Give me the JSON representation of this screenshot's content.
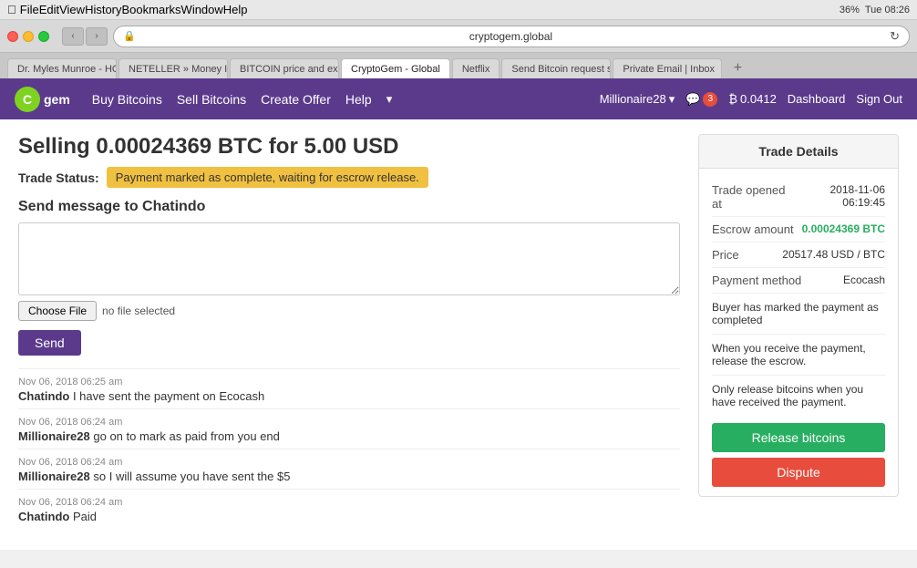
{
  "os": {
    "battery": "36%",
    "time": "Tue 08:26",
    "wifi": "WiFi"
  },
  "browser": {
    "url": "cryptogem.global",
    "tabs": [
      {
        "label": "Dr. Myles Munroe - HOW...",
        "active": false
      },
      {
        "label": "NETELLER » Money In",
        "active": false
      },
      {
        "label": "BITCOIN price and excha...",
        "active": false
      },
      {
        "label": "CryptoGem - Global",
        "active": true
      },
      {
        "label": "Netflix",
        "active": false
      },
      {
        "label": "Send Bitcoin request su...",
        "active": false
      },
      {
        "label": "Private Email | Inbox",
        "active": false
      }
    ]
  },
  "menu": {
    "items": [
      "File",
      "Edit",
      "View",
      "History",
      "Bookmarks",
      "Window",
      "Help"
    ]
  },
  "nav": {
    "logo_text": "gem",
    "links": [
      "Buy Bitcoins",
      "Sell Bitcoins",
      "Create Offer",
      "Help"
    ],
    "user": "Millionaire28",
    "chat_count": "3",
    "balance": "0.0412",
    "dashboard": "Dashboard",
    "signout": "Sign Out"
  },
  "page": {
    "title": "Selling 0.00024369 BTC for 5.00 USD",
    "trade_status_label": "Trade Status:",
    "trade_status_value": "Payment marked as complete, waiting for escrow release.",
    "send_message_title": "Send message to Chatindo",
    "message_placeholder": "",
    "choose_file_label": "Choose File",
    "no_file_label": "no file selected",
    "send_button": "Send",
    "messages": [
      {
        "time": "Nov 06, 2018 06:25 am",
        "author": "Chatindo",
        "text": "I have sent the payment on Ecocash"
      },
      {
        "time": "Nov 06, 2018 06:24 am",
        "author": "Millionaire28",
        "text": "go on to mark as paid from you end"
      },
      {
        "time": "Nov 06, 2018 06:24 am",
        "author": "Millionaire28",
        "text": "so I will assume you have sent the $5"
      },
      {
        "time": "Nov 06, 2018 06:24 am",
        "author": "Chatindo",
        "text": "Paid"
      }
    ]
  },
  "trade_details": {
    "header": "Trade Details",
    "trade_opened_label": "Trade opened at",
    "trade_opened_value": "2018-11-06 06:19:45",
    "escrow_label": "Escrow amount",
    "escrow_value": "0.00024369 BTC",
    "price_label": "Price",
    "price_value": "20517.48 USD / BTC",
    "payment_method_label": "Payment method",
    "payment_method_value": "Ecocash",
    "info1": "Buyer has marked the payment as completed",
    "info2": "When you receive the payment, release the escrow.",
    "info3": "Only release bitcoins when you have received the payment.",
    "release_button": "Release bitcoins",
    "dispute_button": "Dispute"
  }
}
